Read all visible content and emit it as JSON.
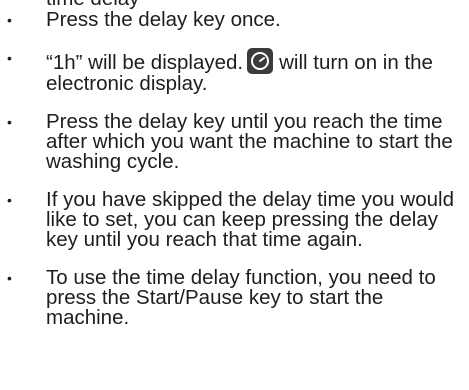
{
  "cropped_top_text": "time delay",
  "steps": [
    {
      "text": "Press the delay key once."
    },
    {
      "text_before_icon": "“1h” will be displayed.",
      "icon": "timer-icon",
      "text_after_icon": "will turn on in the electronic display."
    },
    {
      "text": "Press the delay key until you reach the time after which you want the machine to start the washing cycle."
    },
    {
      "text": "If you have skipped the delay time you would like to set, you can keep pressing the delay key until you reach that time again."
    },
    {
      "text": "To use the time delay function, you need to press the Start/Pause key to start the machine."
    }
  ],
  "bullet_glyph": "•"
}
